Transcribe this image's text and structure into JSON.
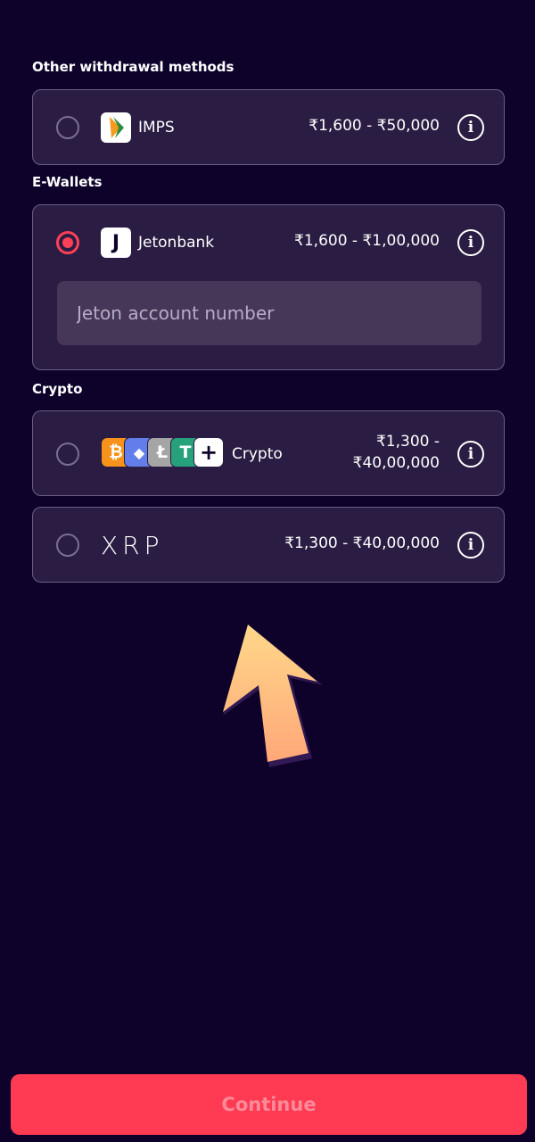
{
  "sections": {
    "other": "Other withdrawal methods",
    "ewallets": "E-Wallets",
    "crypto": "Crypto"
  },
  "methods": {
    "imps": {
      "name": "IMPS",
      "range": "₹1,600 - ₹50,000",
      "selected": false,
      "icon": "imps-logo"
    },
    "jetonbank": {
      "name": "Jetonbank",
      "range": "₹1,600 - ₹1,00,000",
      "selected": true,
      "logo_letter": "J",
      "input_placeholder": "Jeton account number",
      "input_value": ""
    },
    "crypto": {
      "name": "Crypto",
      "range_line1": "₹1,300 -",
      "range_line2": "₹40,00,000",
      "selected": false,
      "coins": [
        "bitcoin-icon",
        "ethereum-icon",
        "litecoin-icon",
        "tether-icon",
        "plus-icon"
      ],
      "coin_glyphs": [
        "₿",
        "◆",
        "Ł",
        "T",
        "+"
      ]
    },
    "xrp": {
      "name": "XRP",
      "range": "₹1,300 - ₹40,00,000",
      "selected": false
    }
  },
  "info_glyph": "i",
  "continue_label": "Continue",
  "colors": {
    "background": "#0e022b",
    "card": "#2a1c42",
    "accent": "#ff3b53",
    "pointer": "#ffc27a"
  }
}
